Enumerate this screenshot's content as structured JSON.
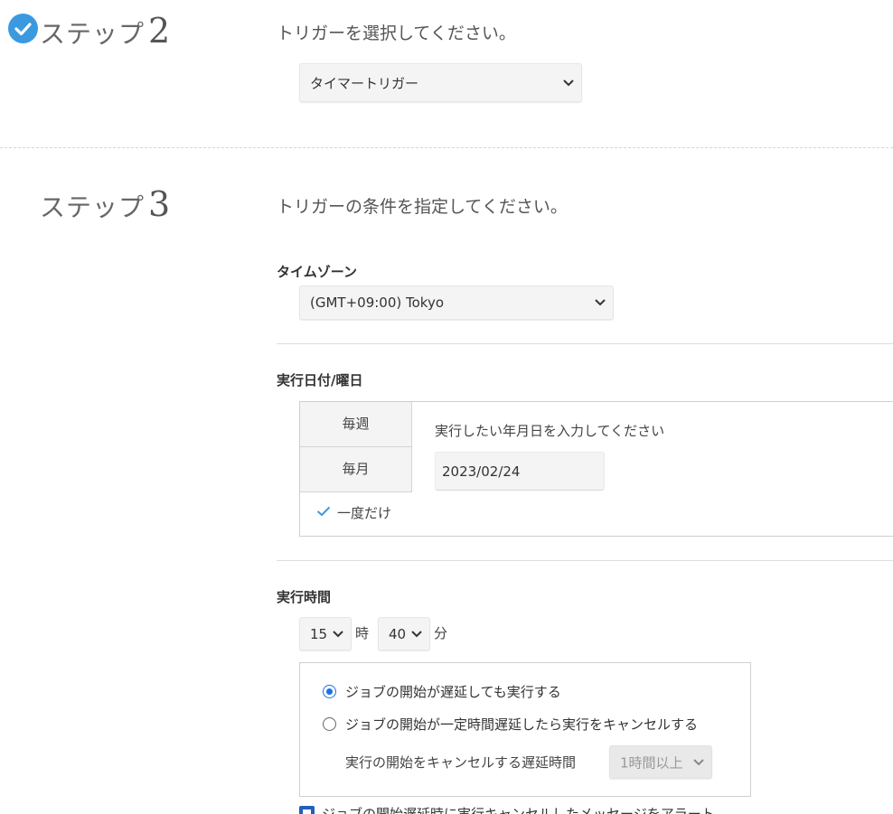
{
  "step2": {
    "word": "ステップ",
    "number": "2",
    "prompt": "トリガーを選択してください。",
    "trigger_select": "タイマートリガー"
  },
  "step3": {
    "word": "ステップ",
    "number": "3",
    "prompt": "トリガーの条件を指定してください。",
    "timezone": {
      "label": "タイムゾーン",
      "value": "(GMT+09:00) Tokyo"
    },
    "exec_date": {
      "label": "実行日付/曜日",
      "tabs": [
        "毎週",
        "毎月"
      ],
      "selected_tab": "一度だけ",
      "hint": "実行したい年月日を入力してください",
      "date_value": "2023/02/24"
    },
    "exec_time": {
      "label": "実行時間",
      "hour": "15",
      "hour_unit": "時",
      "minute": "40",
      "minute_unit": "分",
      "options": [
        {
          "label": "ジョブの開始が遅延しても実行する",
          "selected": true
        },
        {
          "label": "ジョブの開始が一定時間遅延したら実行をキャンセルする",
          "selected": false
        }
      ],
      "cancel_delay_label": "実行の開始をキャンセルする遅延時間",
      "cancel_delay_value": "1時間以上"
    },
    "bottom_text": "ジョブの開始遅延時に実行キャンセルしたメッセージをアラート"
  },
  "colors": {
    "accent": "#3b99e0",
    "radio": "#1a73e8",
    "checkbox": "#1f5fbf"
  }
}
